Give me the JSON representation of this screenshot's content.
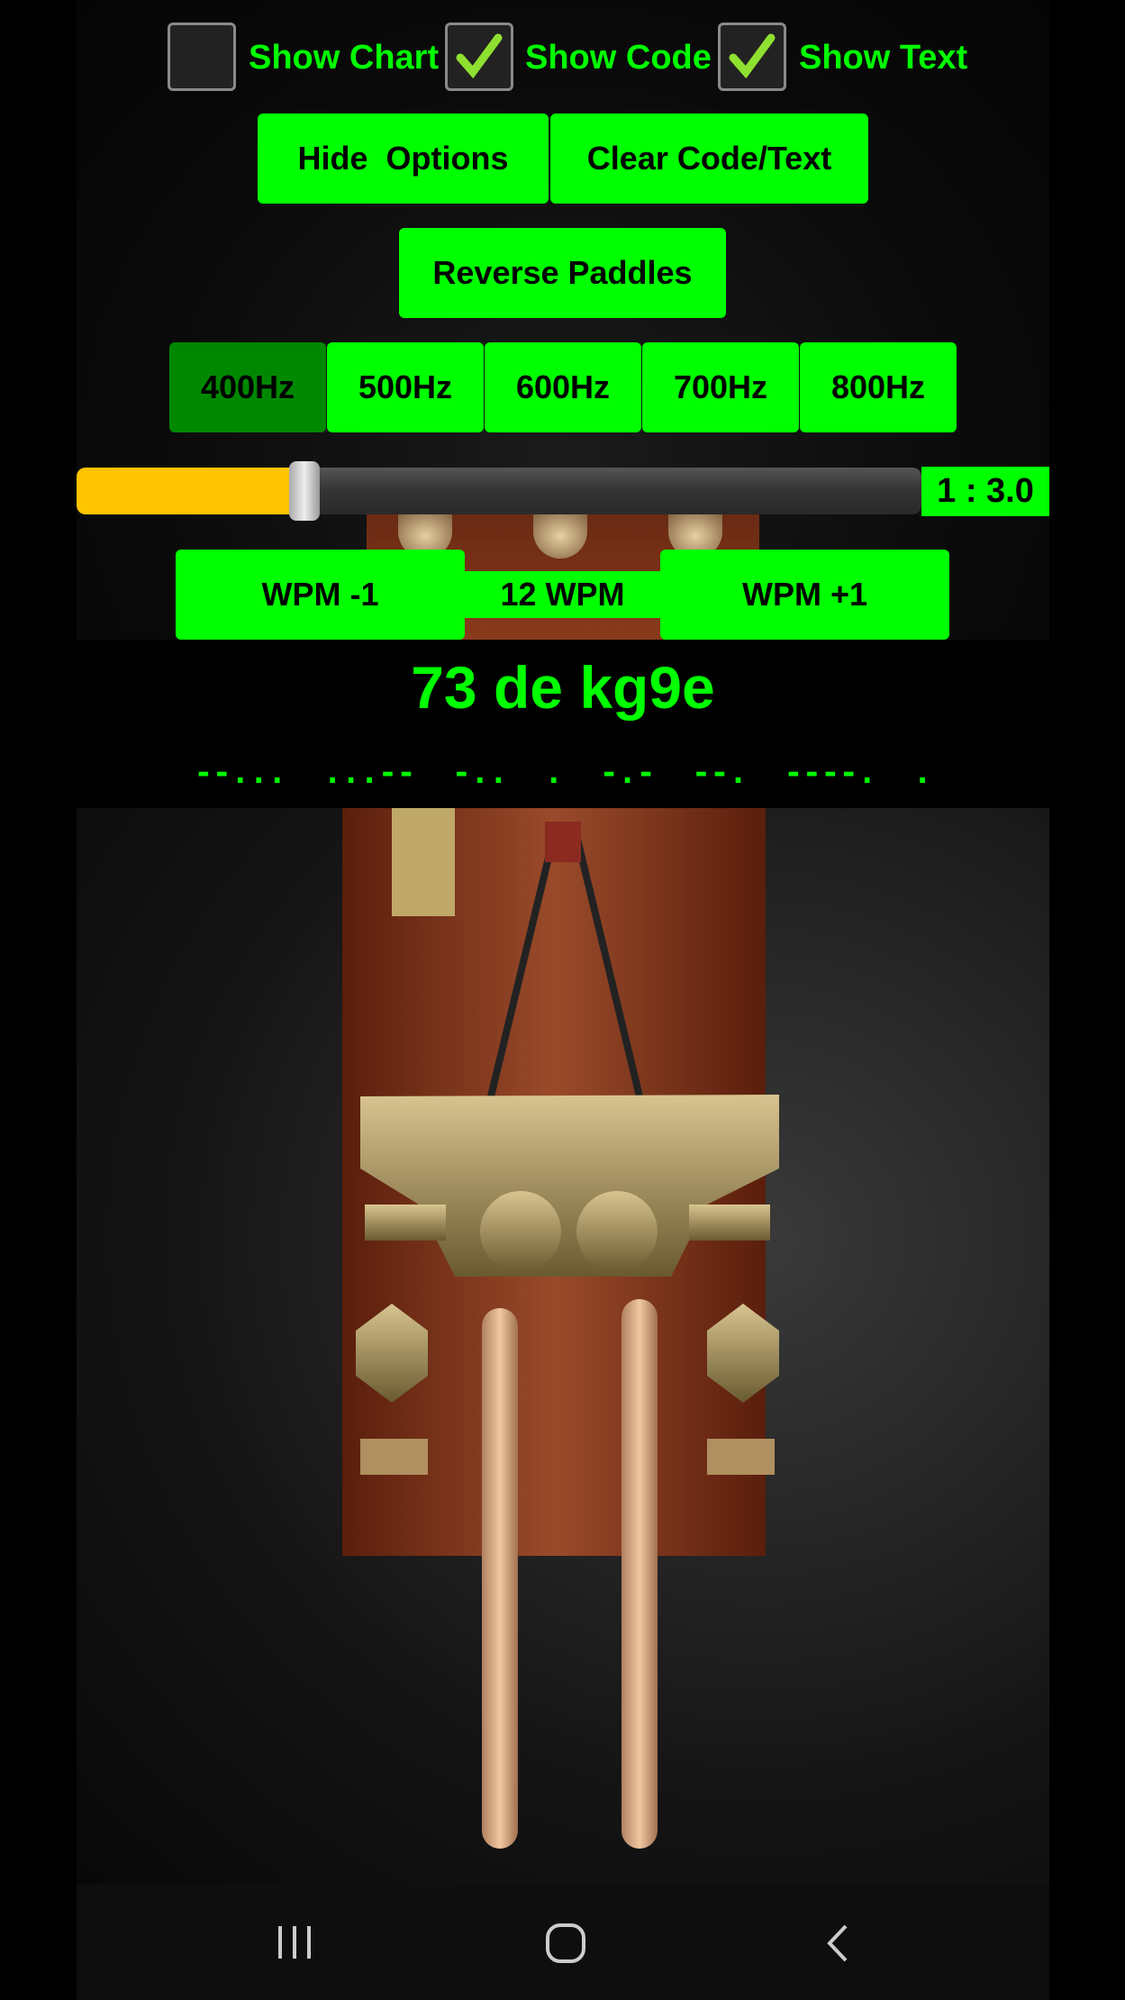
{
  "options": {
    "checkboxes": [
      {
        "label": "Show Chart",
        "checked": false
      },
      {
        "label": "Show Code",
        "checked": true
      },
      {
        "label": "Show Text",
        "checked": true
      }
    ],
    "hide_options_label": "Hide  Options",
    "clear_label": "Clear Code/Text",
    "reverse_paddles_label": "Reverse Paddles",
    "frequencies": [
      {
        "label": "400Hz",
        "selected": true
      },
      {
        "label": "500Hz",
        "selected": false
      },
      {
        "label": "600Hz",
        "selected": false
      },
      {
        "label": "700Hz",
        "selected": false
      },
      {
        "label": "800Hz",
        "selected": false
      }
    ],
    "ratio_slider": {
      "fill_percent": 27,
      "label": "1 : 3.0"
    },
    "wpm_minus_label": "WPM -1",
    "wpm_value": "12 WPM",
    "wpm_plus_label": "WPM +1"
  },
  "decoded_text": "73 de kg9e",
  "morse_code": "--...  ...--  -..  .  -.-  --.  ----.  .",
  "colors": {
    "accent": "#00ff00",
    "selected": "#008800",
    "slider_fill": "#ffc400"
  },
  "navbar": {
    "icons": [
      "recent-apps-icon",
      "home-icon",
      "back-icon"
    ]
  }
}
